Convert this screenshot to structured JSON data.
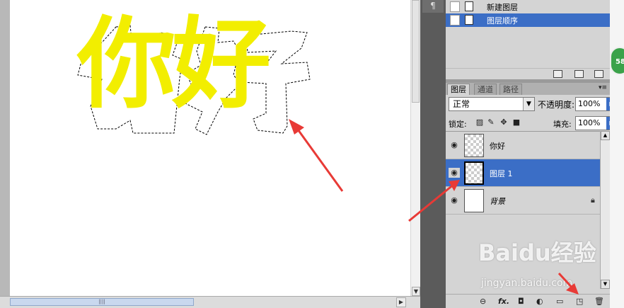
{
  "canvas": {
    "text": "你好",
    "text_color": "#f2ee00",
    "background": "#ffffff"
  },
  "left_tool": {
    "icon": "paragraph-icon",
    "glyph": "¶"
  },
  "history": {
    "items": [
      {
        "label": "新建图层",
        "icon": "document-icon",
        "active": false
      },
      {
        "label": "图层顺序",
        "icon": "document-icon",
        "active": true
      }
    ],
    "footer_icons": [
      "new-snapshot-icon",
      "camera-icon",
      "trash-icon"
    ]
  },
  "layers_panel": {
    "tabs": [
      "图层",
      "通道",
      "路径"
    ],
    "active_tab": "图层",
    "blend_mode": "正常",
    "opacity_label": "不透明度:",
    "opacity_value": "100%",
    "lock_label": "锁定:",
    "fill_label": "填充:",
    "fill_value": "100%",
    "layers": [
      {
        "name": "你好",
        "visible": true,
        "thumbnail": "transparent",
        "selected": false,
        "locked": false
      },
      {
        "name": "图层 1",
        "visible": true,
        "thumbnail": "transparent",
        "selected": true,
        "locked": false
      },
      {
        "name": "背景",
        "visible": true,
        "thumbnail": "white",
        "selected": false,
        "locked": true
      }
    ],
    "footer_icons": [
      "link-icon",
      "fx-icon",
      "mask-icon",
      "adjustment-icon",
      "group-icon",
      "new-layer-icon",
      "trash-icon"
    ],
    "fx_label": "fx."
  },
  "badge": {
    "text": "58",
    "color": "#3aa24a"
  },
  "watermark": {
    "text": "Baidu经验",
    "sub": "jingyan.baidu.com"
  },
  "colors": {
    "selection_blue": "#3b6ec6",
    "panel_gray": "#d4d4d4",
    "arrow_red": "#e83a36"
  }
}
